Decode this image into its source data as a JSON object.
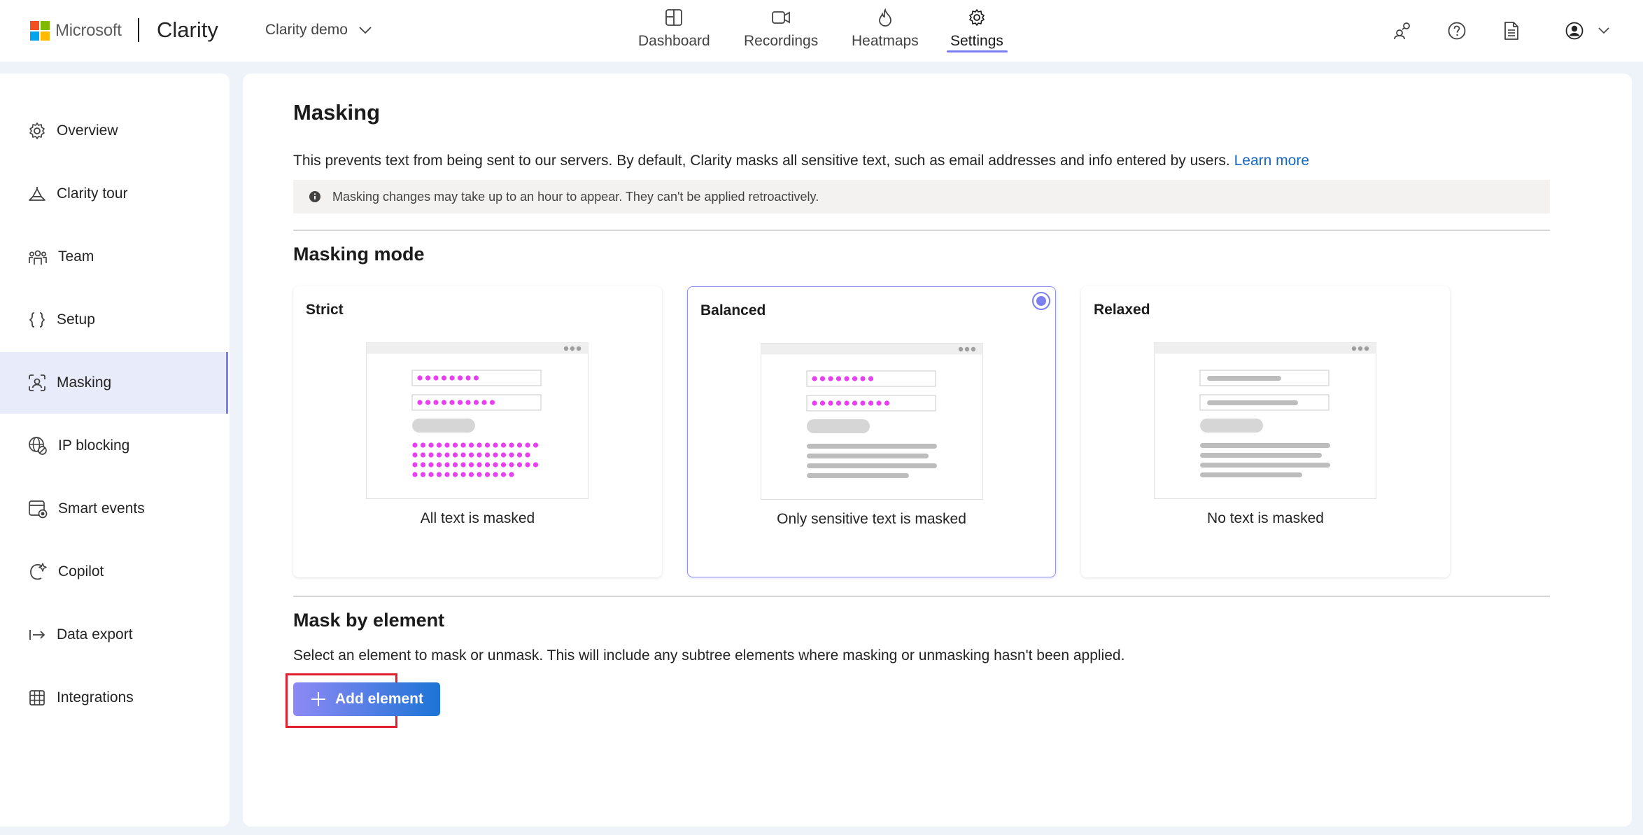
{
  "header": {
    "microsoft": "Microsoft",
    "app_name": "Clarity",
    "project": "Clarity demo",
    "nav": [
      {
        "label": "Dashboard",
        "icon": "dashboard-icon"
      },
      {
        "label": "Recordings",
        "icon": "video-icon"
      },
      {
        "label": "Heatmaps",
        "icon": "flame-icon"
      },
      {
        "label": "Settings",
        "icon": "gear-icon",
        "active": true
      }
    ],
    "accent_color": "#7b7ff0"
  },
  "sidebar": {
    "items": [
      {
        "label": "Overview",
        "icon": "gear-icon"
      },
      {
        "label": "Clarity tour",
        "icon": "hat-icon"
      },
      {
        "label": "Team",
        "icon": "team-icon"
      },
      {
        "label": "Setup",
        "icon": "braces-icon"
      },
      {
        "label": "Masking",
        "icon": "mask-icon",
        "active": true
      },
      {
        "label": "IP blocking",
        "icon": "globe-block-icon"
      },
      {
        "label": "Smart events",
        "icon": "calendar-event-icon"
      },
      {
        "label": "Copilot",
        "icon": "copilot-icon"
      },
      {
        "label": "Data export",
        "icon": "export-icon"
      },
      {
        "label": "Integrations",
        "icon": "grid-icon"
      }
    ]
  },
  "main": {
    "title": "Masking",
    "description": "This prevents text from being sent to our servers. By default, Clarity masks all sensitive text, such as email addresses and info entered by users.",
    "learn_more": "Learn more",
    "notice": "Masking changes may take up to an hour to appear. They can't be applied retroactively.",
    "masking_mode_title": "Masking mode",
    "modes": [
      {
        "name": "Strict",
        "caption": "All text is masked",
        "selected": false
      },
      {
        "name": "Balanced",
        "caption": "Only sensitive text is masked",
        "selected": true
      },
      {
        "name": "Relaxed",
        "caption": "No text is masked",
        "selected": false
      }
    ],
    "mask_by_element_title": "Mask by element",
    "mask_by_element_desc": "Select an element to mask or unmask. This will include any subtree elements where masking or unmasking hasn't been applied.",
    "add_element_label": "Add element",
    "mask_color": "#e83ff2"
  }
}
